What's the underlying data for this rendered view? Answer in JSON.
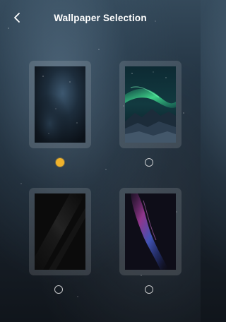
{
  "header": {
    "title": "Wallpaper Selection",
    "back_icon": "chevron-left-icon"
  },
  "wallpapers": [
    {
      "theme": "dark-nebula",
      "selected": true
    },
    {
      "theme": "aurora-mountains",
      "selected": false
    },
    {
      "theme": "black-diagonal",
      "selected": false
    },
    {
      "theme": "purple-light-streak",
      "selected": false
    }
  ],
  "colors": {
    "selected_radio": "#f0b22c",
    "title_text": "#ffffff"
  }
}
